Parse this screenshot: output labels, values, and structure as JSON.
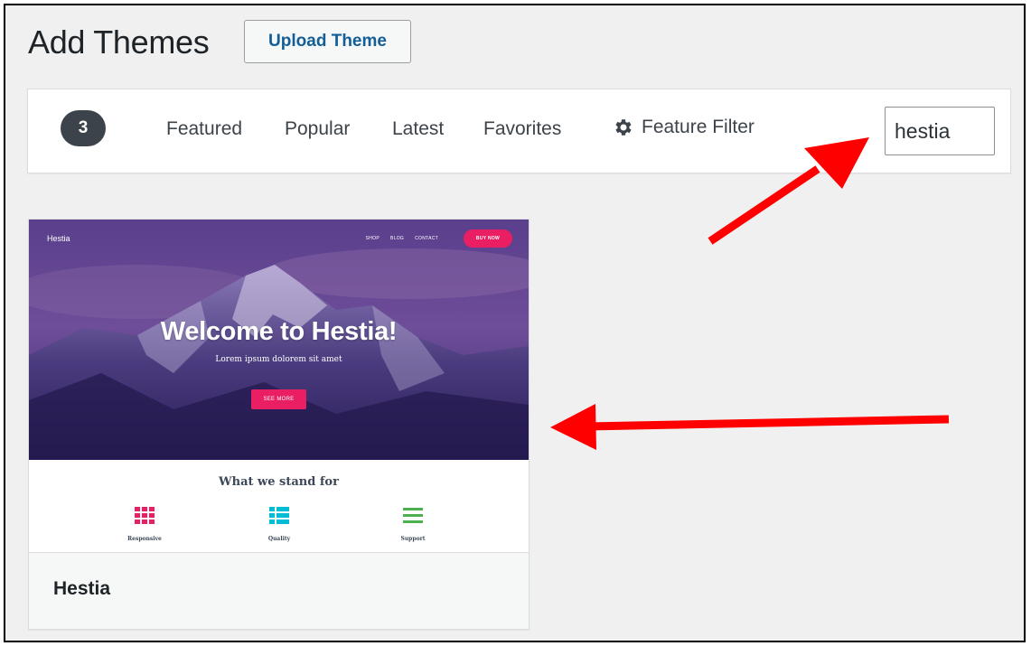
{
  "header": {
    "title": "Add Themes",
    "upload_label": "Upload Theme"
  },
  "filter_bar": {
    "count": "3",
    "tabs": [
      {
        "label": "Featured"
      },
      {
        "label": "Popular"
      },
      {
        "label": "Latest"
      },
      {
        "label": "Favorites"
      }
    ],
    "feature_filter_label": "Feature Filter",
    "feature_filter_icon": "gear-icon",
    "search_value": "hestia"
  },
  "theme": {
    "name": "Hestia",
    "preview": {
      "logo": "Hestia",
      "nav": [
        "SHOP",
        "BLOG",
        "CONTACT"
      ],
      "buy_label": "BUY NOW",
      "hero_title": "Welcome to Hestia!",
      "hero_subtitle": "Lorem ipsum dolorem sit amet",
      "button_label": "SEE MORE",
      "section_title": "What we stand for",
      "features": [
        {
          "label": "Responsive",
          "icon": "grid-icon",
          "color": "#e91e63"
        },
        {
          "label": "Quality",
          "icon": "list-icon",
          "color": "#00bcd4"
        },
        {
          "label": "Support",
          "icon": "menu-icon",
          "color": "#4caf50"
        }
      ]
    }
  },
  "colors": {
    "accent_link": "#135e96",
    "annotation_arrow": "#ff0000",
    "hestia_pink": "#e91e63"
  }
}
